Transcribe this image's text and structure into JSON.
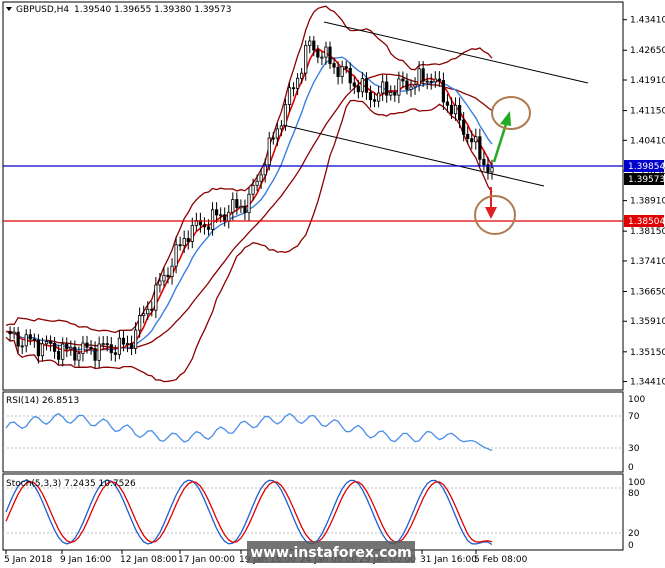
{
  "header": {
    "symbol": "GBPUSD,H4",
    "ohlc": "1.39540 1.39655 1.39380 1.39573"
  },
  "rsi_panel": {
    "label": "RSI(14) 26.8513",
    "levels": [
      "100",
      "70",
      "30",
      "0"
    ]
  },
  "stoch_panel": {
    "label": "Stoch(5,3,3) 7.2435 10.7526",
    "levels": [
      "100",
      "80",
      "20",
      "0"
    ]
  },
  "price_axis": {
    "ticks": [
      "1.43410",
      "1.42650",
      "1.41910",
      "1.41150",
      "1.40410",
      "1.39650",
      "1.38910",
      "1.38150",
      "1.37410",
      "1.36650",
      "1.35910",
      "1.35150",
      "1.34410"
    ]
  },
  "time_axis": {
    "labels": [
      "5 Jan 2018",
      "9 Jan 16:00",
      "12 Jan 08:00",
      "17 Jan 00:00",
      "19 Jan 16:00",
      "24 Jan 08:00",
      "29 Jan 00:00",
      "31 Jan 16:00",
      "5 Feb 08:00"
    ]
  },
  "levels": {
    "resistance": "1.39854",
    "current": "1.39573",
    "support": "1.38504"
  },
  "watermark": "www.instaforex.com",
  "colors": {
    "candle_body": "#000000",
    "fast_ma": "#e00000",
    "mid_ma": "#3a7ee0",
    "bollinger": "#8b0000",
    "resistance_line": "#0000cc",
    "support_line": "#e00000",
    "channel": "#000000",
    "up_arrow": "#22aa22",
    "down_arrow": "#e02020",
    "target_circle": "#b07a50",
    "rsi_line": "#4a8ee8",
    "stoch_main": "#1e5ed0",
    "stoch_signal": "#e00000"
  },
  "chart_data": {
    "type": "line",
    "title": "GBPUSD,H4",
    "series_note": "approximate close path",
    "x": [
      "5 Jan 2018",
      "9 Jan 16:00",
      "12 Jan 08:00",
      "17 Jan 00:00",
      "19 Jan 16:00",
      "24 Jan 08:00",
      "29 Jan 00:00",
      "31 Jan 16:00",
      "5 Feb 08:00"
    ],
    "close": [
      1.3555,
      1.3515,
      1.353,
      1.3815,
      1.389,
      1.428,
      1.415,
      1.42,
      1.3957
    ],
    "ylim": [
      1.342,
      1.4385
    ],
    "rsi_last": 26.8513,
    "stoch_main_last": 7.2435,
    "stoch_signal_last": 10.7526
  }
}
